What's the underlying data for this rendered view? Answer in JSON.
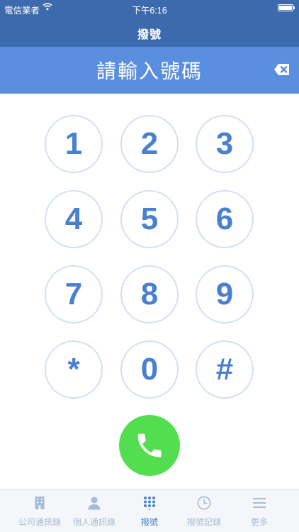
{
  "status_bar": {
    "carrier": "電信業者",
    "time": "下午6:16"
  },
  "header": {
    "title": "撥號"
  },
  "entry": {
    "placeholder": "請輸入號碼"
  },
  "keypad": {
    "keys": [
      "1",
      "2",
      "3",
      "4",
      "5",
      "6",
      "7",
      "8",
      "9",
      "*",
      "0",
      "#"
    ]
  },
  "tabs": [
    {
      "label": "公司通訊錄",
      "icon": "building-icon",
      "active": false
    },
    {
      "label": "個人通訊錄",
      "icon": "person-icon",
      "active": false
    },
    {
      "label": "撥號",
      "icon": "keypad-icon",
      "active": true
    },
    {
      "label": "撥號記錄",
      "icon": "clock-icon",
      "active": false
    },
    {
      "label": "更多",
      "icon": "menu-icon",
      "active": false
    }
  ],
  "colors": {
    "header_bg": "#3d6aac",
    "entry_bg": "#5a8ede",
    "key_text": "#4a80d0",
    "key_border": "#d4e0f1",
    "call_button": "#53de50",
    "tab_active": "#4a80d0",
    "tab_inactive": "#a9bbd6"
  }
}
